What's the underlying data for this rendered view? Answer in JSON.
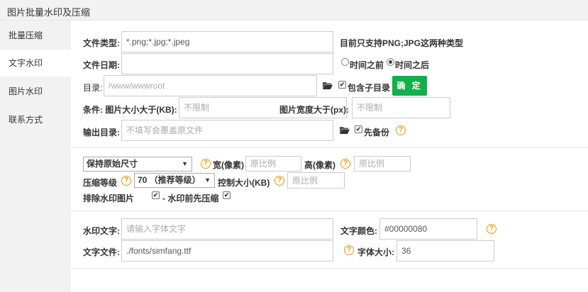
{
  "window": {
    "title": "图片批量水印及压缩"
  },
  "sidebar": {
    "items": [
      {
        "label": "批量压缩"
      },
      {
        "label": "文字水印"
      },
      {
        "label": "图片水印"
      },
      {
        "label": "联系方式"
      }
    ],
    "active_index": 1
  },
  "section1": {
    "file_type_label": "文件类型:",
    "file_type_value": "*.png;*.jpg;*.jpeg",
    "file_type_note": "目前只支持PNG;JPG这两种类型",
    "file_date_label": "文件日期:",
    "file_date_value": "",
    "radio_before_label": "时间之前",
    "radio_after_label": "时间之后",
    "radio_selected": "after",
    "dir_label": "目录:",
    "dir_placeholder": "/www/wwwroot",
    "include_subdir_label": "包含子目录",
    "include_subdir_checked": true,
    "confirm_label": "确 定",
    "cond_label": "条件: 图片大小大于(KB):",
    "cond_size_placeholder": "不限制",
    "cond_width_label": "图片宽度大于(px):",
    "cond_width_placeholder": "不限制",
    "output_label": "输出目录:",
    "output_placeholder": "不填写会覆盖原文件",
    "backup_label": "先备份",
    "backup_checked": true
  },
  "section2": {
    "size_mode_value": "保持原始尺寸",
    "width_label": "宽(像素)",
    "width_placeholder": "原比例",
    "height_label": "高(像素)",
    "height_placeholder": "原比例",
    "level_label": "压缩等级",
    "level_value": "70  （推荐等级）",
    "control_size_label": "控制大小(KB)",
    "control_size_placeholder": "原比例",
    "exclude_label": "排除水印图片",
    "exclude_checked": true,
    "precompress_label": "- 水印前先压缩",
    "precompress_checked": true
  },
  "section3": {
    "watermark_text_label": "水印文字:",
    "watermark_text_placeholder": "请输入字体文字",
    "color_label": "文字颜色:",
    "color_value": "#00000080",
    "font_file_label": "文字文件:",
    "font_file_value": "./fonts/simfang.ttf",
    "font_size_label": "字体大小:",
    "font_size_value": "36"
  },
  "colors": {
    "accent": "#11b04a",
    "help": "#f0930c",
    "sidebar_bg": "#f2f2f2"
  },
  "icons": {
    "help": "question-circle-icon",
    "folder": "folder-open-icon",
    "check": "checkbox-icon"
  }
}
